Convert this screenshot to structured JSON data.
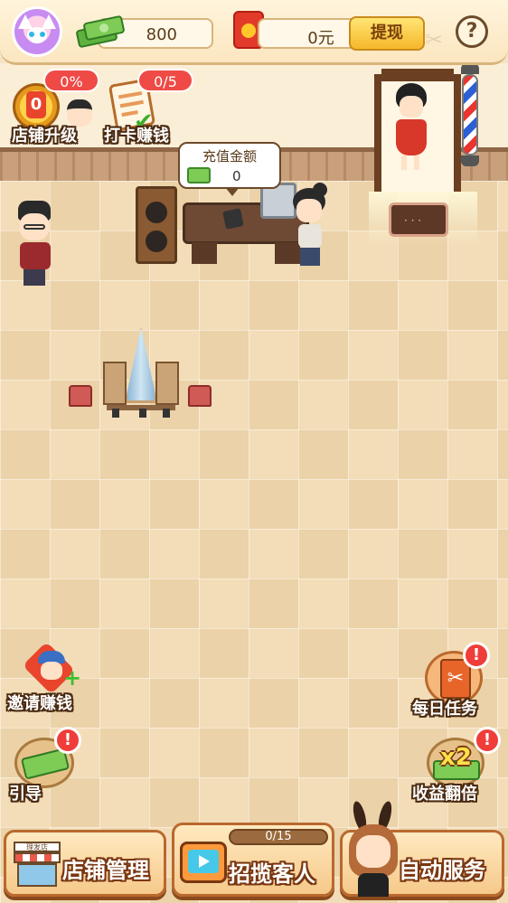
{
  "topbar": {
    "cash_amount": "800",
    "redpacket_amount": "0元",
    "withdraw_label": "提现",
    "help_label": "?"
  },
  "hud": {
    "shop_upgrade": {
      "badge": "0%",
      "level": "0",
      "label": "店铺升级"
    },
    "checkin": {
      "badge": "0/5",
      "label": "打卡赚钱"
    }
  },
  "counter": {
    "title": "充值金额",
    "value": "0"
  },
  "side_left": {
    "invite_label": "邀请赚钱",
    "guide_label": "引导"
  },
  "side_right": {
    "daily_tasks_label": "每日任务",
    "double_income_label": "收益翻倍",
    "double_badge": "x2",
    "alert_mark": "!"
  },
  "bottom": {
    "shop_manage_label": "店铺管理",
    "shop_sign": "理发店",
    "attract_label": "招揽客人",
    "attract_progress_text": "0/15",
    "attract_progress": 0,
    "auto_service_label": "自动服务"
  },
  "colors": {
    "accent_orange": "#f6c98a",
    "alert_red": "#ef3d3a",
    "cash_green": "#7ecb55"
  }
}
